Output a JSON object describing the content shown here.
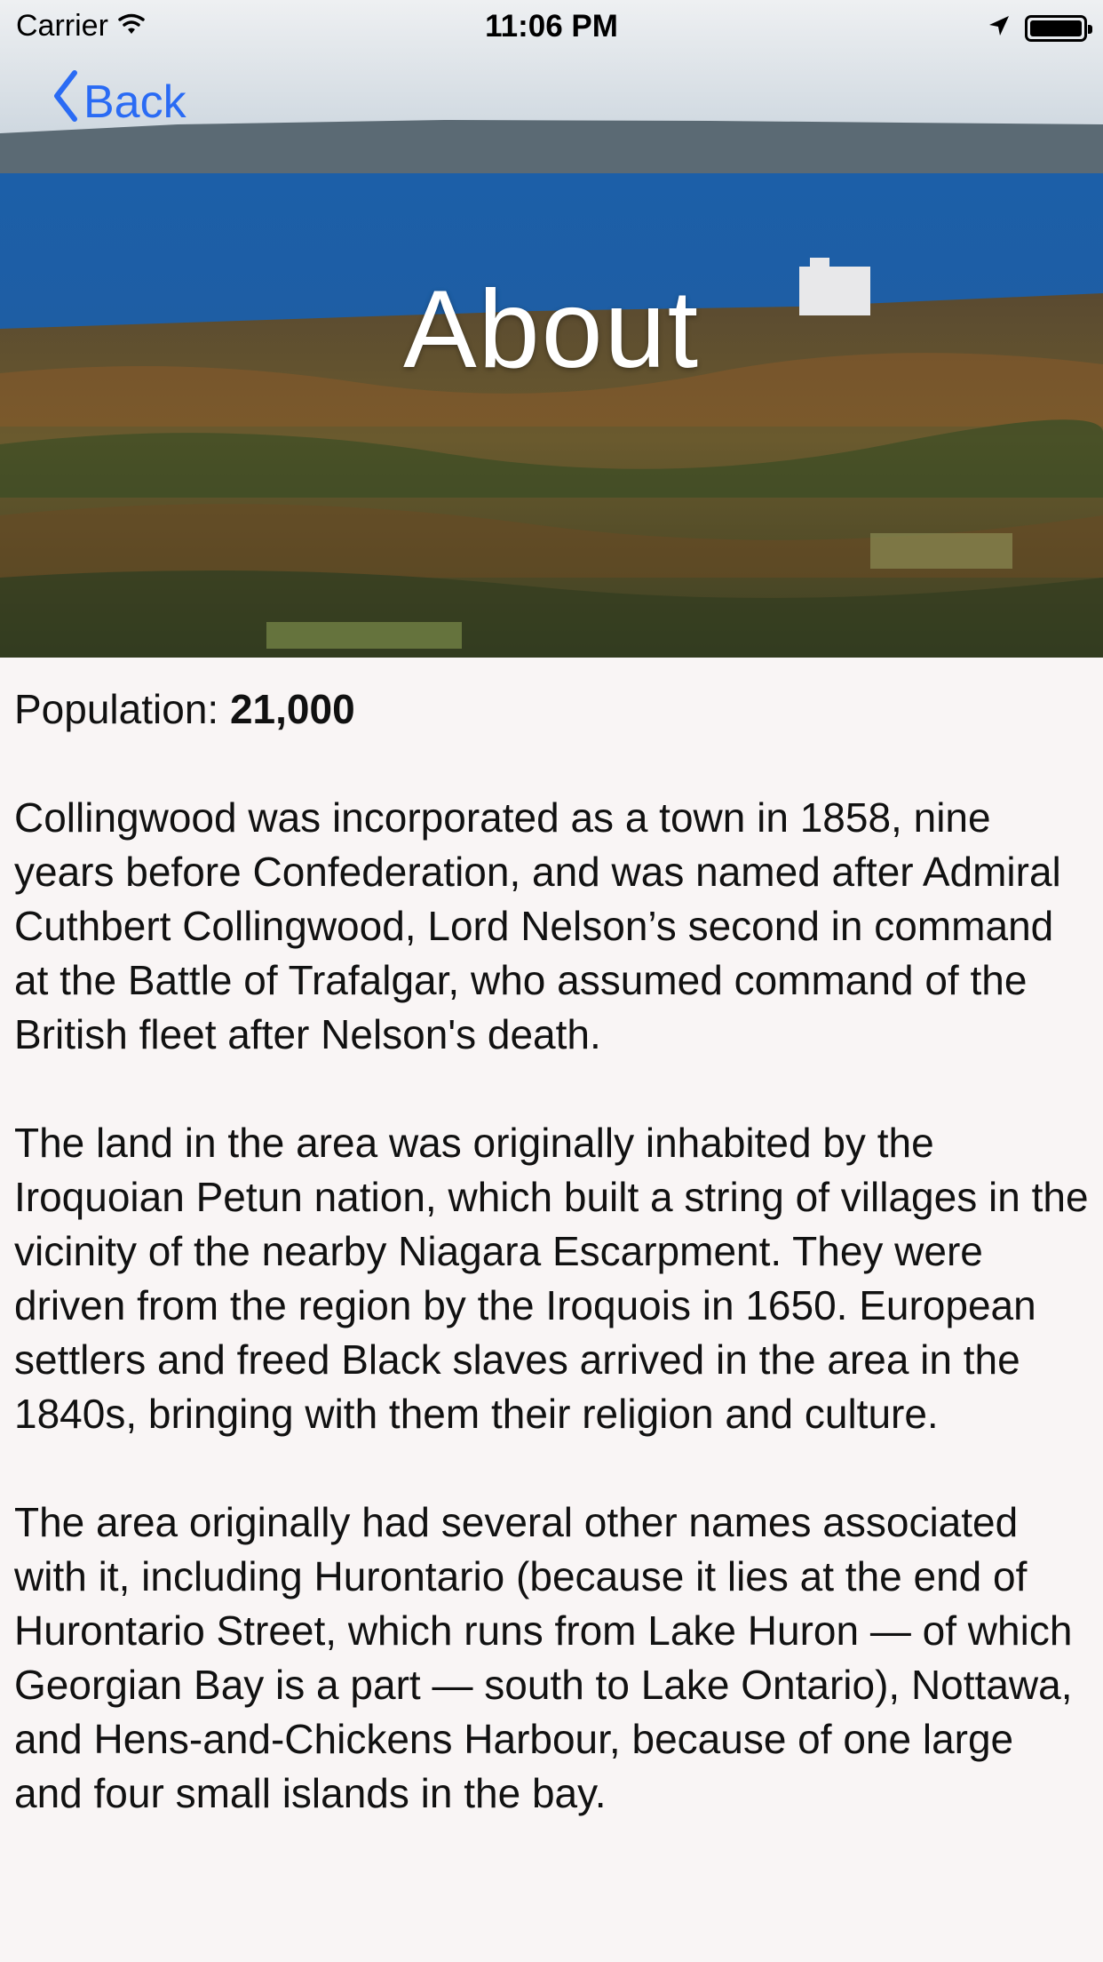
{
  "status_bar": {
    "carrier": "Carrier",
    "time": "11:06 PM",
    "icons": [
      "wifi-icon",
      "location-arrow-icon",
      "battery-icon"
    ]
  },
  "nav": {
    "back_label": "Back",
    "accent_color": "#2a6bf4"
  },
  "header": {
    "title": "About"
  },
  "population": {
    "label": "Population:",
    "value": "21,000"
  },
  "paragraphs": [
    "Collingwood was incorporated as a town in 1858, nine years before Confederation, and was named after Admiral Cuthbert Collingwood, Lord Nelson’s second in command at the Battle of Trafalgar, who assumed command of the British fleet after Nelson's death.",
    "The land in the area was originally inhabited by the Iroquoian Petun nation, which built a string of villages in the vicinity of the nearby Niagara Escarpment. They were driven from the region by the Iroquois in 1650. European settlers and freed Black slaves arrived in the area in the 1840s, bringing with them their religion and culture.",
    "The area originally had several other names associated with it, including Hurontario (because it lies at the end of Hurontario Street, which runs from Lake Huron — of which Georgian Bay is a part — south to Lake Ontario), Nottawa, and Hens-and-Chickens Harbour, because of one large and four small islands in the bay."
  ]
}
